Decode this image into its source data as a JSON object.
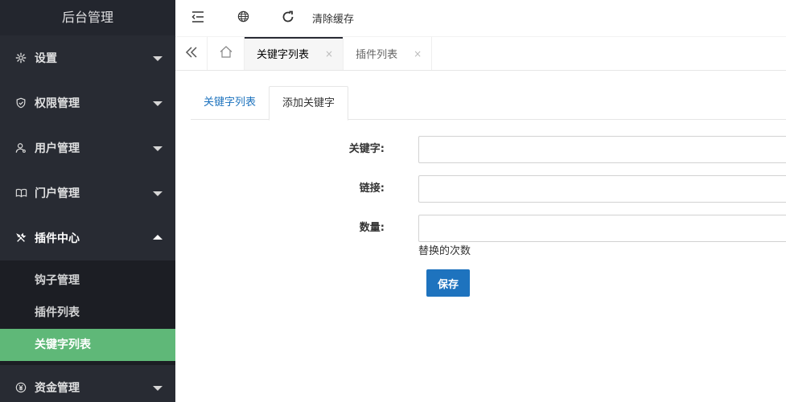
{
  "app": {
    "title": "后台管理"
  },
  "colors": {
    "sidebar_bg": "#282b33",
    "submenu_bg": "#1c1e24",
    "active_item": "#5fb878",
    "primary": "#1e73be"
  },
  "sidebar": {
    "menus": [
      {
        "label": "设置",
        "icon": "gear-icon",
        "state": "collapsed"
      },
      {
        "label": "权限管理",
        "icon": "shield-check-icon",
        "state": "collapsed"
      },
      {
        "label": "用户管理",
        "icon": "user-icon",
        "state": "collapsed"
      },
      {
        "label": "门户管理",
        "icon": "book-icon",
        "state": "collapsed"
      },
      {
        "label": "插件中心",
        "icon": "tools-icon",
        "state": "expanded"
      },
      {
        "label": "资金管理",
        "icon": "yen-icon",
        "state": "collapsed"
      }
    ],
    "submenu": [
      {
        "label": "钩子管理"
      },
      {
        "label": "插件列表"
      },
      {
        "label": "关键字列表",
        "active": true
      }
    ]
  },
  "header": {
    "toggle_icon": "menu-fold-icon",
    "globe_icon": "globe-icon",
    "refresh_icon": "refresh-icon",
    "clear_cache_label": "清除缓存"
  },
  "page_tabs": [
    {
      "label": "关键字列表",
      "active": true,
      "close": "×"
    },
    {
      "label": "插件列表",
      "active": false,
      "close": "×"
    }
  ],
  "content": {
    "tabs": [
      {
        "label": "关键字列表",
        "active": false
      },
      {
        "label": "添加关键字",
        "active": true
      }
    ],
    "form": {
      "keyword_label": "关键字:",
      "keyword_value": "",
      "link_label": "链接:",
      "link_value": "",
      "count_label": "数量:",
      "count_value": "",
      "count_hint": "替换的次数",
      "save_label": "保存"
    }
  }
}
